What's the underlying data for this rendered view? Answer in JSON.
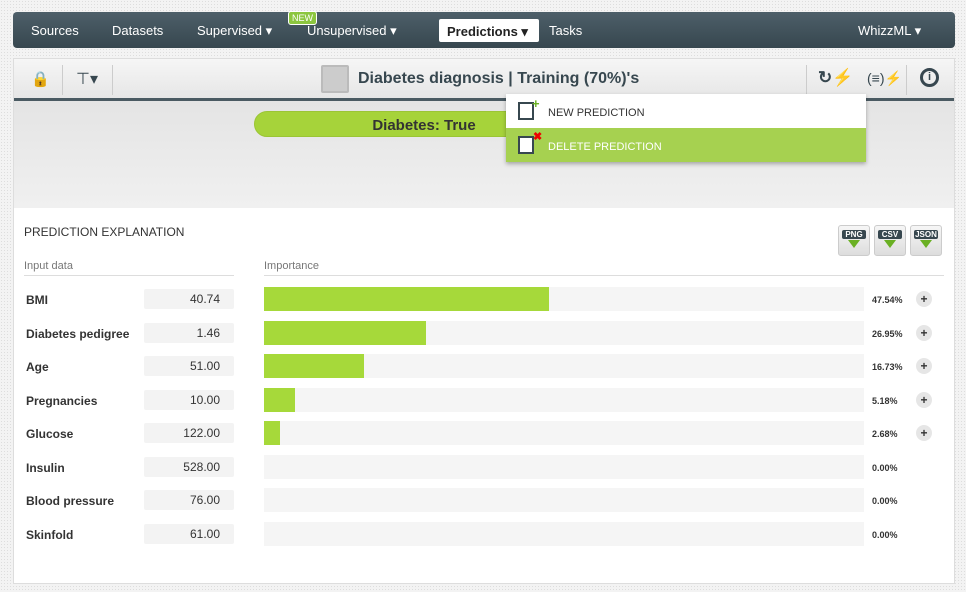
{
  "nav": {
    "items": [
      "Sources",
      "Datasets",
      "Supervised ▾",
      "Unsupervised ▾",
      "Tasks"
    ],
    "active": "Predictions ▾",
    "new_badge": "NEW",
    "right": "WhizzML ▾"
  },
  "toolbar": {
    "title": "Diabetes diagnosis | Training (70%)'s"
  },
  "prediction": {
    "result": "Diabetes: True"
  },
  "menu": {
    "items": [
      "NEW PREDICTION",
      "DELETE PREDICTION"
    ],
    "selected": "DELETE PREDICTION"
  },
  "explanation": {
    "title": "PREDICTION EXPLANATION",
    "input_header": "Input data",
    "importance_header": "Importance",
    "downloads": [
      "PNG",
      "CSV",
      "JSON"
    ],
    "rows": [
      {
        "name": "BMI",
        "value": "40.74",
        "importance": 47.54,
        "pct": "47.54%",
        "expandable": true
      },
      {
        "name": "Diabetes pedigree",
        "value": "1.46",
        "importance": 26.95,
        "pct": "26.95%",
        "expandable": true
      },
      {
        "name": "Age",
        "value": "51.00",
        "importance": 16.73,
        "pct": "16.73%",
        "expandable": true
      },
      {
        "name": "Pregnancies",
        "value": "10.00",
        "importance": 5.18,
        "pct": "5.18%",
        "expandable": true
      },
      {
        "name": "Glucose",
        "value": "122.00",
        "importance": 2.68,
        "pct": "2.68%",
        "expandable": true
      },
      {
        "name": "Insulin",
        "value": "528.00",
        "importance": 0,
        "pct": "0.00%",
        "expandable": false
      },
      {
        "name": "Blood pressure",
        "value": "76.00",
        "importance": 0,
        "pct": "0.00%",
        "expandable": false
      },
      {
        "name": "Skinfold",
        "value": "61.00",
        "importance": 0,
        "pct": "0.00%",
        "expandable": false
      }
    ]
  },
  "colors": {
    "accent": "#a6d93a",
    "nav": "#37474f"
  }
}
